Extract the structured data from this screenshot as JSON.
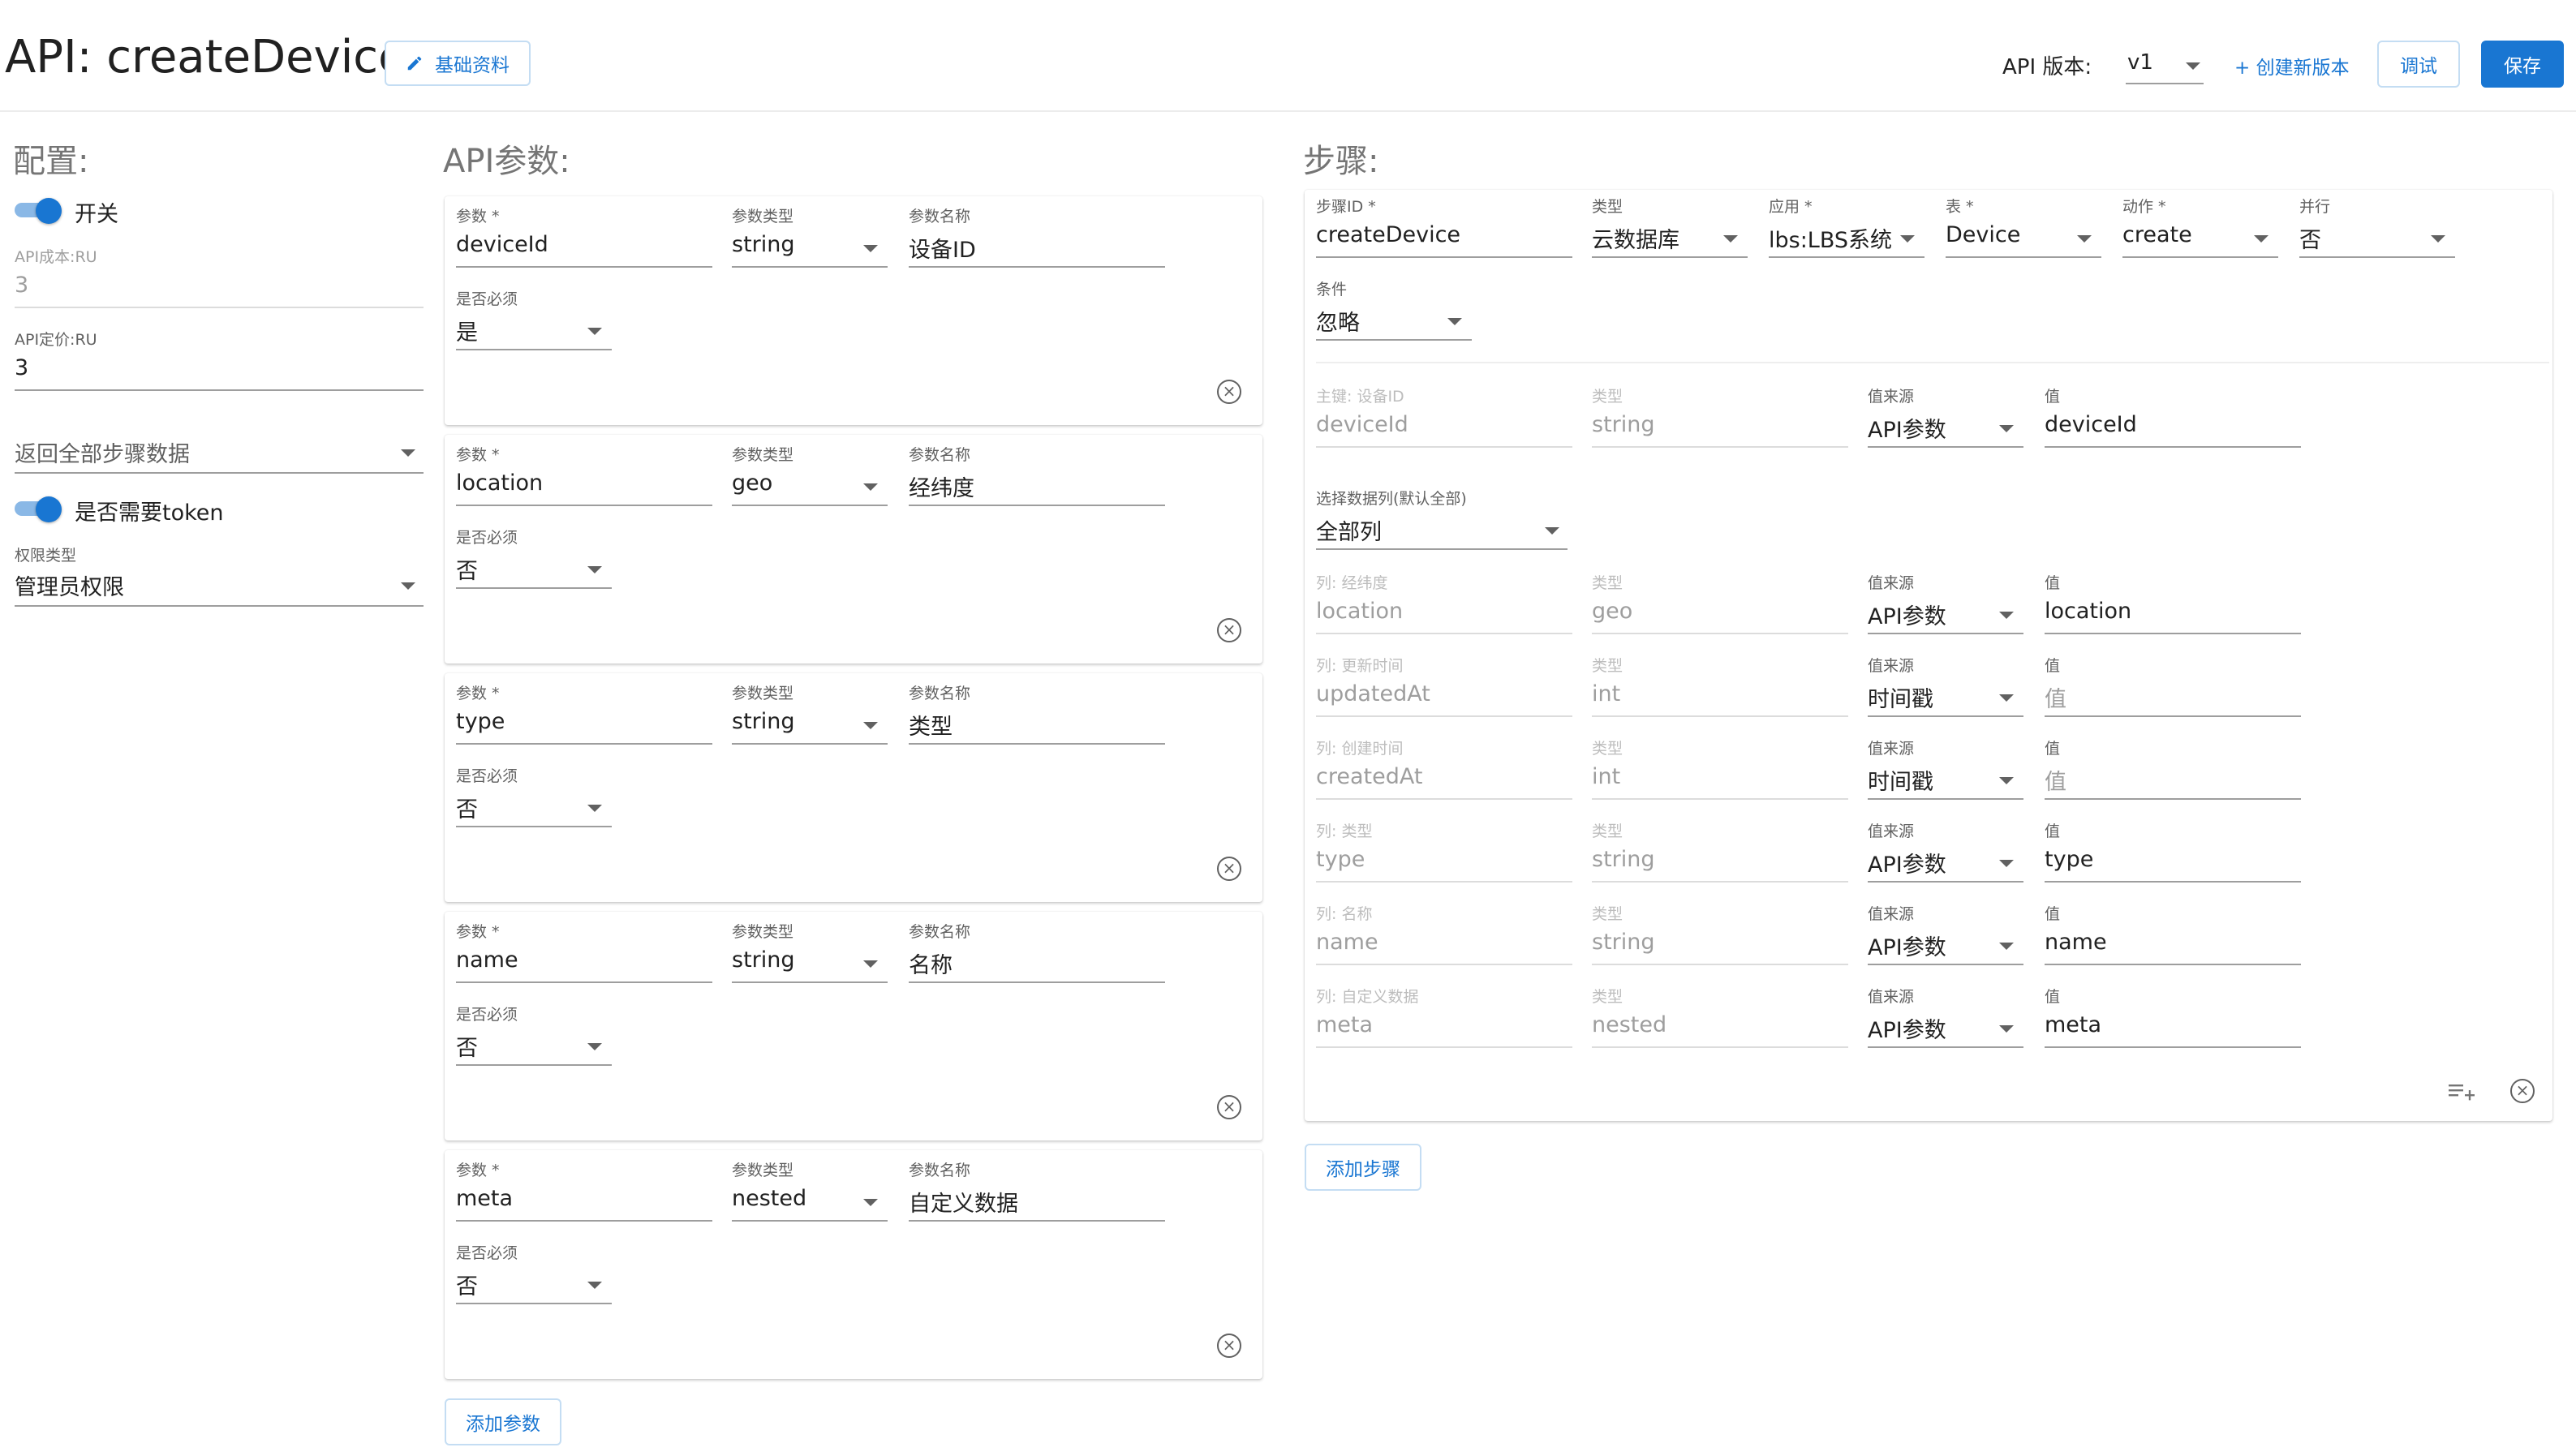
{
  "header": {
    "title": "API: createDevice",
    "basic_info_label": "基础资料",
    "version_label": "API 版本:",
    "version_value": "v1",
    "create_version_label": "+ 创建新版本",
    "debug_label": "调试",
    "save_label": "保存"
  },
  "config": {
    "title": "配置:",
    "switch_label": "开关",
    "cost_label": "API成本:RU",
    "cost_value": "3",
    "price_label": "API定价:RU",
    "price_value": "3",
    "return_select": "返回全部步骤数据",
    "token_label": "是否需要token",
    "permission_label": "权限类型",
    "permission_value": "管理员权限"
  },
  "params": {
    "title": "API参数:",
    "param_label": "参数 *",
    "type_label": "参数类型",
    "name_label": "参数名称",
    "required_label": "是否必须",
    "items": [
      {
        "param": "deviceId",
        "type": "string",
        "name": "设备ID",
        "required": "是"
      },
      {
        "param": "location",
        "type": "geo",
        "name": "经纬度",
        "required": "否"
      },
      {
        "param": "type",
        "type": "string",
        "name": "类型",
        "required": "否"
      },
      {
        "param": "name",
        "type": "string",
        "name": "名称",
        "required": "否"
      },
      {
        "param": "meta",
        "type": "nested",
        "name": "自定义数据",
        "required": "否"
      }
    ],
    "add_label": "添加参数"
  },
  "steps": {
    "title": "步骤:",
    "step_id_label": "步骤ID *",
    "step_id_value": "createDevice",
    "type_label": "类型",
    "type_value": "云数据库",
    "app_label": "应用 *",
    "app_value": "lbs:LBS系统",
    "table_label": "表 *",
    "table_value": "Device",
    "action_label": "动作 *",
    "action_value": "create",
    "parallel_label": "并行",
    "parallel_value": "否",
    "condition_label": "条件",
    "condition_value": "忽略",
    "key_label": "主键: 设备ID",
    "key_value": "deviceId",
    "key_type_label": "类型",
    "key_type_value": "string",
    "key_source_label": "值来源",
    "key_source_value": "API参数",
    "key_val_label": "值",
    "key_val_value": "deviceId",
    "columns_select_label": "选择数据列(默认全部)",
    "columns_select_value": "全部列",
    "col_type_label": "类型",
    "col_source_label": "值来源",
    "col_val_label": "值",
    "columns": [
      {
        "label": "列: 经纬度",
        "col": "location",
        "type": "geo",
        "source": "API参数",
        "value": "location",
        "value_placeholder": false
      },
      {
        "label": "列: 更新时间",
        "col": "updatedAt",
        "type": "int",
        "source": "时间戳",
        "value": "值",
        "value_placeholder": true
      },
      {
        "label": "列: 创建时间",
        "col": "createdAt",
        "type": "int",
        "source": "时间戳",
        "value": "值",
        "value_placeholder": true
      },
      {
        "label": "列: 类型",
        "col": "type",
        "type": "string",
        "source": "API参数",
        "value": "type",
        "value_placeholder": false
      },
      {
        "label": "列: 名称",
        "col": "name",
        "type": "string",
        "source": "API参数",
        "value": "name",
        "value_placeholder": false
      },
      {
        "label": "列: 自定义数据",
        "col": "meta",
        "type": "nested",
        "source": "API参数",
        "value": "meta",
        "value_placeholder": false
      }
    ],
    "add_label": "添加步骤"
  },
  "colors": {
    "accent": "#1976d2",
    "toggle_track": "#8ab8e6"
  }
}
